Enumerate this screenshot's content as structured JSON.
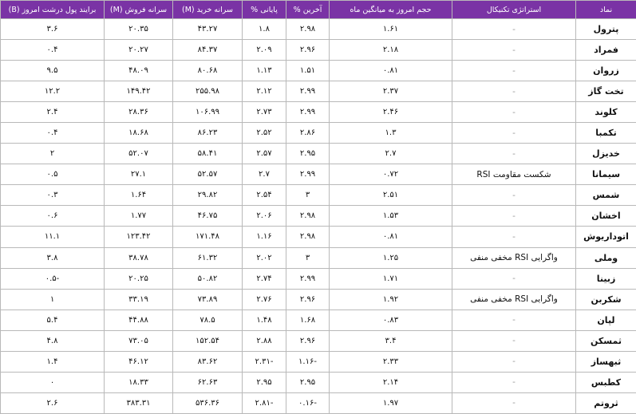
{
  "headers": [
    "نماد",
    "استراتژی تکنیکال",
    "حجم امروز به میانگین ماه",
    "آخرین %",
    "پایانی %",
    "سرانه خرید (M)",
    "سرانه فروش (M)",
    "برایند پول درشت امروز (B)"
  ],
  "rows": [
    {
      "symbol": "پترول",
      "strategy": "-",
      "volume_ratio": "۱.۶۱",
      "last": "۲.۹۸",
      "close": "۱.۸",
      "buy_per_capita": "۴۳.۲۷",
      "sell_per_capita": "۲۰.۳۵",
      "money_flow": "۳.۶"
    },
    {
      "symbol": "فمراد",
      "strategy": "-",
      "volume_ratio": "۲.۱۸",
      "last": "۲.۹۶",
      "close": "۲.۰۹",
      "buy_per_capita": "۸۴.۳۷",
      "sell_per_capita": "۲۰.۲۷",
      "money_flow": "۰.۴"
    },
    {
      "symbol": "زروان",
      "strategy": "-",
      "volume_ratio": "۰.۸۱",
      "last": "۱.۵۱",
      "close": "۱.۱۳",
      "buy_per_capita": "۸۰.۶۸",
      "sell_per_capita": "۴۸.۰۹",
      "money_flow": "۹.۵"
    },
    {
      "symbol": "تخت گاز",
      "strategy": "-",
      "volume_ratio": "۲.۳۷",
      "last": "۲.۹۹",
      "close": "۲.۱۲",
      "buy_per_capita": "۲۵۵.۹۸",
      "sell_per_capita": "۱۴۹.۴۲",
      "money_flow": "۱۲.۲"
    },
    {
      "symbol": "کلوند",
      "strategy": "-",
      "volume_ratio": "۲.۴۶",
      "last": "۲.۹۹",
      "close": "۲.۷۳",
      "buy_per_capita": "۱۰۶.۹۹",
      "sell_per_capita": "۲۸.۳۶",
      "money_flow": "۲.۴"
    },
    {
      "symbol": "تکمبا",
      "strategy": "-",
      "volume_ratio": "۱.۳",
      "last": "۲.۸۶",
      "close": "۲.۵۲",
      "buy_per_capita": "۸۶.۲۳",
      "sell_per_capita": "۱۸.۶۸",
      "money_flow": "۰.۴"
    },
    {
      "symbol": "خدیزل",
      "strategy": "-",
      "volume_ratio": "۲.۷",
      "last": "۲.۹۵",
      "close": "۲.۵۷",
      "buy_per_capita": "۵۸.۴۱",
      "sell_per_capita": "۵۲.۰۷",
      "money_flow": "۲"
    },
    {
      "symbol": "سیمانا",
      "strategy": "شکست مقاومت RSI",
      "volume_ratio": "۰.۷۲",
      "last": "۲.۹۹",
      "close": "۲.۷",
      "buy_per_capita": "۵۲.۵۷",
      "sell_per_capita": "۲۷.۱",
      "money_flow": "۰.۵"
    },
    {
      "symbol": "شمس",
      "strategy": "-",
      "volume_ratio": "۲.۵۱",
      "last": "۳",
      "close": "۲.۵۴",
      "buy_per_capita": "۲۹.۸۲",
      "sell_per_capita": "۱.۶۴",
      "money_flow": "۰.۳"
    },
    {
      "symbol": "اخشان",
      "strategy": "-",
      "volume_ratio": "۱.۵۳",
      "last": "۲.۹۸",
      "close": "۲.۰۶",
      "buy_per_capita": "۴۶.۷۵",
      "sell_per_capita": "۱.۷۷",
      "money_flow": "۰.۶"
    },
    {
      "symbol": "اتوداریوش",
      "strategy": "-",
      "volume_ratio": "۰.۸۱",
      "last": "۲.۹۸",
      "close": "۱.۱۶",
      "buy_per_capita": "۱۷۱.۴۸",
      "sell_per_capita": "۱۲۳.۴۲",
      "money_flow": "۱۱.۱"
    },
    {
      "symbol": "وملی",
      "strategy": "واگرایی RSI مخفی منفی",
      "volume_ratio": "۱.۲۵",
      "last": "۳",
      "close": "۲.۰۲",
      "buy_per_capita": "۶۱.۳۲",
      "sell_per_capita": "۳۸.۷۸",
      "money_flow": "۳.۸"
    },
    {
      "symbol": "زبینا",
      "strategy": "-",
      "volume_ratio": "۱.۷۱",
      "last": "۲.۹۹",
      "close": "۲.۷۴",
      "buy_per_capita": "۵۰.۸۲",
      "sell_per_capita": "۲۰.۲۵",
      "money_flow": "-۰.۵"
    },
    {
      "symbol": "شکربن",
      "strategy": "واگرایی RSI مخفی منفی",
      "volume_ratio": "۱.۹۲",
      "last": "۲.۹۶",
      "close": "۲.۷۶",
      "buy_per_capita": "۷۳.۸۹",
      "sell_per_capita": "۳۳.۱۹",
      "money_flow": "۱"
    },
    {
      "symbol": "لپان",
      "strategy": "-",
      "volume_ratio": "۰.۸۳",
      "last": "۱.۶۸",
      "close": "۱.۴۸",
      "buy_per_capita": "۷۸.۵",
      "sell_per_capita": "۴۴.۸۸",
      "money_flow": "۵.۴"
    },
    {
      "symbol": "ثمسکن",
      "strategy": "-",
      "volume_ratio": "۳.۴",
      "last": "۲.۹۶",
      "close": "۲.۸۸",
      "buy_per_capita": "۱۵۲.۵۴",
      "sell_per_capita": "۷۳.۰۵",
      "money_flow": "۴.۸"
    },
    {
      "symbol": "ثبهساز",
      "strategy": "-",
      "volume_ratio": "۲.۳۳",
      "last": "-۱.۱۶",
      "close": "-۲.۳۱",
      "buy_per_capita": "۸۳.۶۲",
      "sell_per_capita": "۴۶.۱۲",
      "money_flow": "۱.۴"
    },
    {
      "symbol": "کطبس",
      "strategy": "-",
      "volume_ratio": "۲.۱۴",
      "last": "۲.۹۵",
      "close": "۲.۹۵",
      "buy_per_capita": "۶۲.۶۳",
      "sell_per_capita": "۱۸.۳۳",
      "money_flow": "۰"
    },
    {
      "symbol": "ثروتم",
      "strategy": "-",
      "volume_ratio": "۱.۹۷",
      "last": "-۰.۱۶",
      "close": "-۲.۸۱",
      "buy_per_capita": "۵۳۶.۳۶",
      "sell_per_capita": "۳۸۳.۳۱",
      "money_flow": "۲.۶"
    }
  ],
  "colors": {
    "header_background": "#7a33a5",
    "header_text": "#ffffff",
    "grid_line": "#b9b9b9"
  }
}
